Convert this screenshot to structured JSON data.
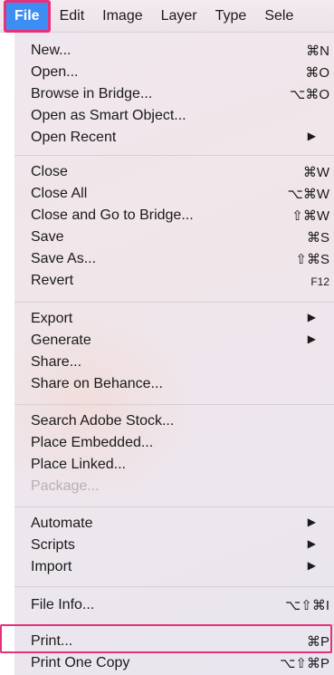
{
  "menubar": {
    "items": [
      "File",
      "Edit",
      "Image",
      "Layer",
      "Type",
      "Sele"
    ]
  },
  "file_menu": {
    "items": [
      {
        "label": "New...",
        "shortcut": "⌘N"
      },
      {
        "label": "Open...",
        "shortcut": "⌘O"
      },
      {
        "label": "Browse in Bridge...",
        "shortcut": "⌥⌘O"
      },
      {
        "label": "Open as Smart Object...",
        "shortcut": ""
      },
      {
        "label": "Open Recent",
        "shortcut": "▶"
      },
      {
        "label": "Close",
        "shortcut": "⌘W"
      },
      {
        "label": "Close All",
        "shortcut": "⌥⌘W"
      },
      {
        "label": "Close and Go to Bridge...",
        "shortcut": "⇧⌘W"
      },
      {
        "label": "Save",
        "shortcut": "⌘S"
      },
      {
        "label": "Save As...",
        "shortcut": "⇧⌘S"
      },
      {
        "label": "Revert",
        "shortcut": "F12"
      },
      {
        "label": "Export",
        "shortcut": "▶"
      },
      {
        "label": "Generate",
        "shortcut": "▶"
      },
      {
        "label": "Share...",
        "shortcut": ""
      },
      {
        "label": "Share on Behance...",
        "shortcut": ""
      },
      {
        "label": "Search Adobe Stock...",
        "shortcut": ""
      },
      {
        "label": "Place Embedded...",
        "shortcut": ""
      },
      {
        "label": "Place Linked...",
        "shortcut": ""
      },
      {
        "label": "Package...",
        "shortcut": ""
      },
      {
        "label": "Automate",
        "shortcut": "▶"
      },
      {
        "label": "Scripts",
        "shortcut": "▶"
      },
      {
        "label": "Import",
        "shortcut": "▶"
      },
      {
        "label": "File Info...",
        "shortcut": "⌥⇧⌘I"
      },
      {
        "label": "Print...",
        "shortcut": "⌘P"
      },
      {
        "label": "Print One Copy",
        "shortcut": "⌥⇧⌘P"
      }
    ]
  },
  "colors": {
    "accent": "#3d8ef4",
    "highlight_outline": "#e5307a",
    "disabled_text": "#b8b0b6"
  }
}
